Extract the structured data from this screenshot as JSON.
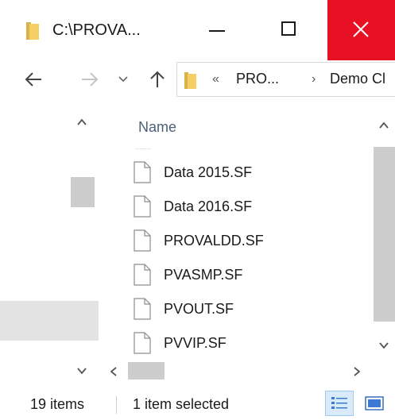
{
  "window": {
    "title": "C:\\PROVA...",
    "close_color": "#e81123"
  },
  "navigation": {
    "back_icon": "arrow-left",
    "forward_icon": "arrow-right",
    "recent_icon": "chevron-down",
    "up_icon": "arrow-up"
  },
  "address": {
    "overflow": "«",
    "crumbs": [
      "PRO...",
      "Demo Cl"
    ],
    "separator": "›"
  },
  "file_list": {
    "column_header": "Name",
    "files": [
      {
        "name": "Data 2015.SF"
      },
      {
        "name": "Data 2016.SF"
      },
      {
        "name": "PROVALDD.SF"
      },
      {
        "name": "PVASMP.SF"
      },
      {
        "name": "PVOUT.SF"
      },
      {
        "name": "PVVIP.SF"
      }
    ]
  },
  "status": {
    "item_count": "19 items",
    "selection": "1 item selected"
  },
  "view_buttons": {
    "details_icon": "details-view-icon",
    "tiles_icon": "tiles-view-icon",
    "active_color": "#d9ebfb"
  }
}
